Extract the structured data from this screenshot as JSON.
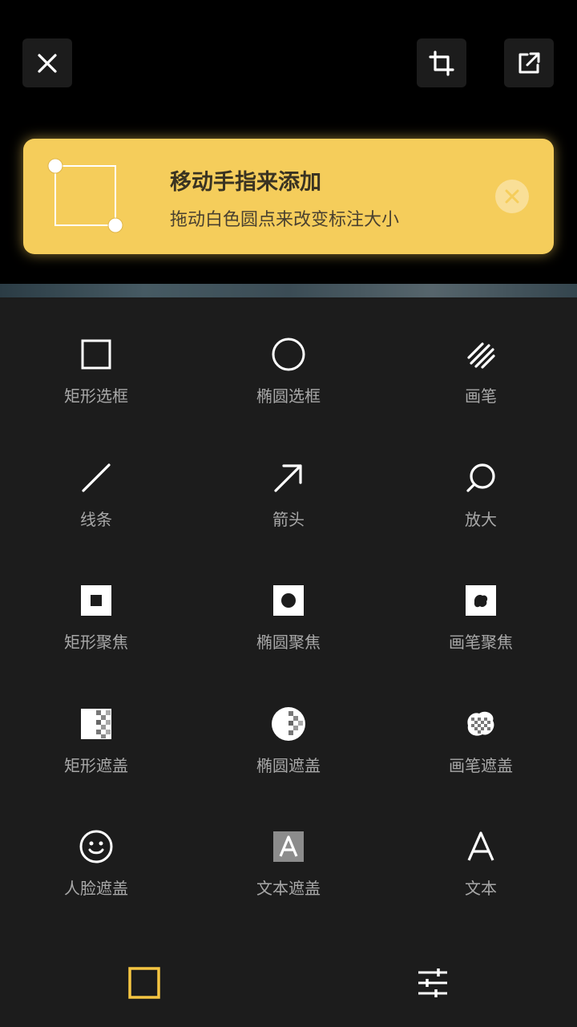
{
  "toolbar": {
    "close_icon": "close-icon",
    "crop_icon": "crop-icon",
    "share_icon": "share-icon"
  },
  "tip": {
    "title": "移动手指来添加",
    "description": "拖动白色圆点来改变标注大小",
    "accent_color": "#f5cd5b"
  },
  "tools": [
    {
      "label": "矩形选框",
      "icon": "rectangle-icon"
    },
    {
      "label": "椭圆选框",
      "icon": "ellipse-icon"
    },
    {
      "label": "画笔",
      "icon": "brush-icon"
    },
    {
      "label": "线条",
      "icon": "line-icon"
    },
    {
      "label": "箭头",
      "icon": "arrow-icon"
    },
    {
      "label": "放大",
      "icon": "magnify-icon"
    },
    {
      "label": "矩形聚焦",
      "icon": "rectangle-focus-icon"
    },
    {
      "label": "椭圆聚焦",
      "icon": "ellipse-focus-icon"
    },
    {
      "label": "画笔聚焦",
      "icon": "brush-focus-icon"
    },
    {
      "label": "矩形遮盖",
      "icon": "rectangle-mosaic-icon"
    },
    {
      "label": "椭圆遮盖",
      "icon": "ellipse-mosaic-icon"
    },
    {
      "label": "画笔遮盖",
      "icon": "brush-mosaic-icon"
    },
    {
      "label": "人脸遮盖",
      "icon": "face-mosaic-icon"
    },
    {
      "label": "文本遮盖",
      "icon": "text-mosaic-icon"
    },
    {
      "label": "文本",
      "icon": "text-icon"
    }
  ],
  "bottom_tabs": {
    "shapes_icon": "shapes-tab-icon",
    "adjust_icon": "adjust-sliders-icon",
    "active_color": "#f5c542"
  }
}
